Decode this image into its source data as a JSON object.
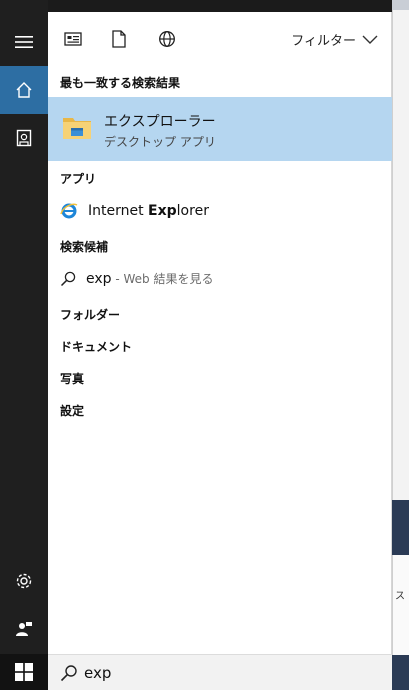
{
  "topbar": {
    "filter_label": "フィルター"
  },
  "sections": {
    "best_match": "最も一致する検索結果",
    "apps": "アプリ",
    "suggestions": "検索候補",
    "folders": "フォルダー",
    "documents": "ドキュメント",
    "photos": "写真",
    "settings": "設定"
  },
  "best_match": {
    "title": "エクスプローラー",
    "subtitle": "デスクトップ アプリ"
  },
  "apps": [
    {
      "prefix": "Internet ",
      "bold": "Exp",
      "suffix": "lorer"
    }
  ],
  "suggestion": {
    "term": "exp",
    "hint": " - Web 結果を見る"
  },
  "search": {
    "value": "exp"
  },
  "desktop": {
    "fragment_text": "ス"
  },
  "colors": {
    "accent": "#2d6ea3",
    "highlight": "#b5d6f0"
  }
}
